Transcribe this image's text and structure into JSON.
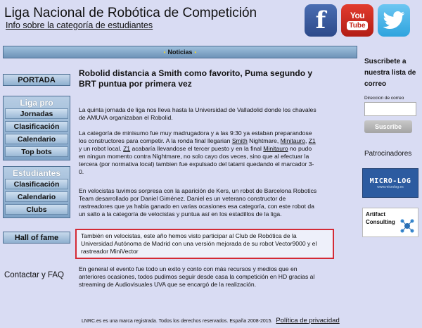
{
  "header": {
    "title": "Liga Nacional de Robótica de Competición",
    "subtitle": "Info sobre la categoría de estudiantes",
    "social": {
      "facebook": "f",
      "youtube_you": "You",
      "youtube_tube": "Tube",
      "twitter": "twitter-bird"
    }
  },
  "newsbar": {
    "dot": "•",
    "label": "Noticias"
  },
  "nav": {
    "portada": "PORTADA",
    "liga_pro": {
      "heading": "Liga pro",
      "items": [
        "Jornadas",
        "Clasificación",
        "Calendario",
        "Top bots"
      ]
    },
    "estudiantes": {
      "heading": "Estudiantes",
      "items": [
        "Clasificación",
        "Calendario",
        "Clubs"
      ]
    },
    "hall": "Hall of fame",
    "contact": "Contactar y FAQ"
  },
  "article": {
    "title": "Robolid distancia a Smith como favorito, Puma segundo y BRT puntua por primera vez",
    "p1": "La quinta jornada de liga nos lleva hasta la Universidad de Valladolid donde los chavales de AMUVA organizaban el Robolid.",
    "p2": {
      "t1": "La categoría de minisumo fue muy madrugadora y a las 9:30 ya estaban preparandose los constructores para competir. A la ronda final llegarian ",
      "l1": "Smith",
      "t2": " Nightmare, ",
      "l2": "Minitauro",
      "t3": ", ",
      "l3": "Z1",
      "t4": " y un robot local. ",
      "l4": "Z1",
      "t5": " acabaría llevandose el tercer puesto y en la final ",
      "l5": "Minitauro",
      "t6": " no pudo en ningun momento contra Nightmare, no solo cayo dos veces, sino que al efectuar la tercera (por normativa local) tambien fue expulsado del tatami quedando el marcador 3-0."
    },
    "p3": "En velocistas tuvimos sorpresa con la aparición de Kers, un robot de Barcelona Robotics Team desarrollado por Daniel Giménez. Daniel es un veterano constructor de rastreadores que ya habia ganado en varias ocasiones esa categoría, con este robot da un salto a la categoría de velocistas y puntua así en los estadillos de la liga.",
    "p4": "También en velocistas, este año hemos visto participar al Club de Robótica de la Universidad Autónoma de Madrid con una versión mejorada de su robot Vector9000 y el rastreador MiniVector",
    "p5": "En general el evento fue todo un exito y conto con más recursos y medios que en anteriores ocasiones, todos pudimos seguir desde casa la competición en HD gracias al streaming de Audiovisuales UVA que se encargó de la realización."
  },
  "footer": {
    "text": "LNRC.es es una marca registrada. Todos los derechos reservados. España 2008-2015.",
    "policy": "Política de privacidad"
  },
  "sidebar": {
    "subscribe_title": "Suscribete a nuestra lista de correo",
    "email_label": "Direccion de correo",
    "email_value": "",
    "subscribe_button": "Suscribe",
    "sponsors_title": "Patrocinadores",
    "sponsor1": {
      "name": "MICRO-LOG",
      "url": "www.microlog.es"
    },
    "sponsor2": {
      "line1": "Artifact",
      "line2": "Consulting"
    }
  },
  "colors": {
    "background": "#d9dcf3",
    "highlight_border": "#d42a35",
    "nav_blue": "#8fb0cf"
  }
}
